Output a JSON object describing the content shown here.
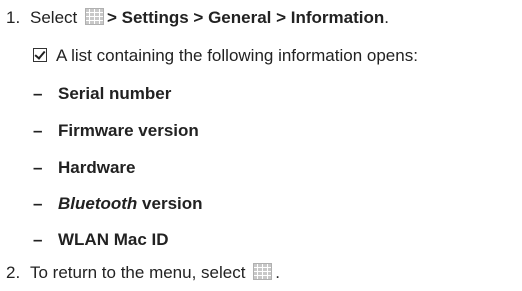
{
  "step1": {
    "number": "1.",
    "prefix": "Select",
    "path": "> Settings > General > Information",
    "suffix": "."
  },
  "result_text": "A list containing the following information opens:",
  "items": [
    {
      "dash": "–",
      "label": "Serial number"
    },
    {
      "dash": "–",
      "label": "Firmware version"
    },
    {
      "dash": "–",
      "label": "Hardware"
    },
    {
      "dash": "–",
      "label_italic": "Bluetooth",
      "label": " version"
    },
    {
      "dash": "–",
      "label": "WLAN Mac ID"
    }
  ],
  "step2": {
    "number": "2.",
    "text": "To return to the menu, select",
    "suffix": "."
  },
  "icons": {
    "menu": "menu-grid-icon",
    "result": "checkbox-checked-icon"
  }
}
